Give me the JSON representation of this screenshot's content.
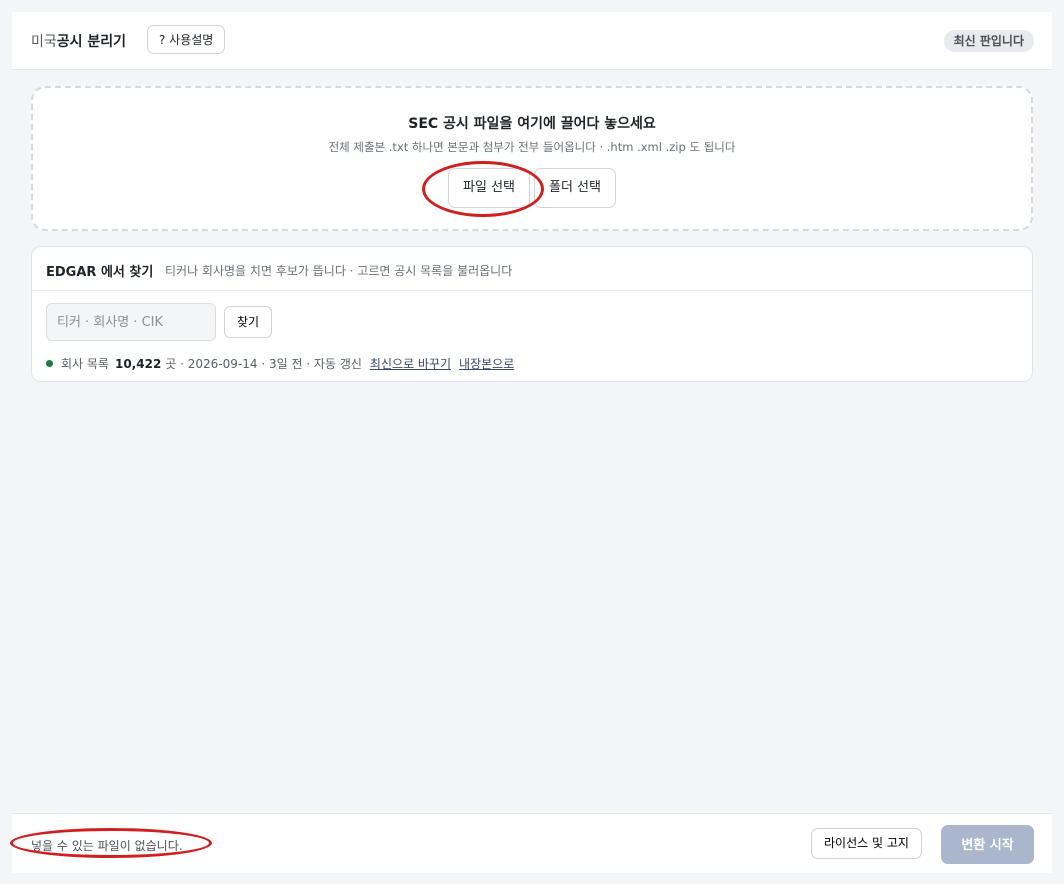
{
  "header": {
    "title_prefix": "미국",
    "title_main": "공시 분리기",
    "help_label": "? 사용설명",
    "version_badge": "최신 판입니다"
  },
  "dropzone": {
    "title": "SEC 공시 파일을 여기에 끌어다 놓으세요",
    "subtitle": "전체 제출본 .txt 하나면 본문과 첨부가 전부 들어옵니다 · .htm .xml .zip 도 됩니다",
    "file_button": "파일 선택",
    "folder_button": "폴더 선택"
  },
  "edgar": {
    "title": "EDGAR 에서 찾기",
    "description": "티커나 회사명을 치면 후보가 뜹니다 · 고르면 공시 목록을 불러옵니다",
    "search_placeholder": "티커 · 회사명 · CIK",
    "search_button": "찾기",
    "status": {
      "label": "회사 목록",
      "count": "10,422",
      "details": "곳 · 2026-09-14 · 3일 전 · 자동 갱신",
      "refresh_link": "최신으로 바꾸기",
      "builtin_link": "내장본으로",
      "dot_color": "#1d7a3f"
    }
  },
  "footer": {
    "message": "넣을 수 있는 파일이 없습니다.",
    "license_button": "라이선스 및 고지",
    "convert_button": "변환 시작"
  },
  "colors": {
    "accent_disabled": "#a9b6cb",
    "annotation_ring": "#d11f1f"
  }
}
